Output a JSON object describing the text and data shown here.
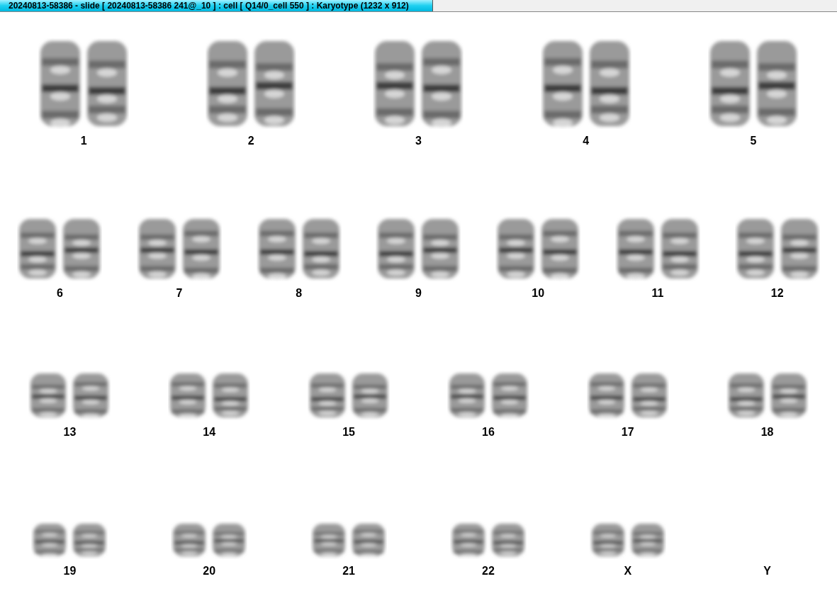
{
  "window": {
    "title": "20240813-58386 - slide [ 20240813-58386 241@_10 ] : cell [ Q14/0_cell 550 ] : Karyotype  (1232 x 912)"
  },
  "karyotype": {
    "rows": [
      {
        "groups": [
          {
            "label": "1",
            "kind": "pair"
          },
          {
            "label": "2",
            "kind": "pair"
          },
          {
            "label": "3",
            "kind": "pair"
          },
          {
            "label": "4",
            "kind": "pair"
          },
          {
            "label": "5",
            "kind": "pair"
          }
        ]
      },
      {
        "groups": [
          {
            "label": "6",
            "kind": "pair"
          },
          {
            "label": "7",
            "kind": "pair"
          },
          {
            "label": "8",
            "kind": "pair"
          },
          {
            "label": "9",
            "kind": "pair"
          },
          {
            "label": "10",
            "kind": "pair"
          },
          {
            "label": "11",
            "kind": "pair"
          },
          {
            "label": "12",
            "kind": "pair"
          }
        ]
      },
      {
        "groups": [
          {
            "label": "13",
            "kind": "pair"
          },
          {
            "label": "14",
            "kind": "pair"
          },
          {
            "label": "15",
            "kind": "pair"
          },
          {
            "label": "16",
            "kind": "pair"
          },
          {
            "label": "17",
            "kind": "pair"
          },
          {
            "label": "18",
            "kind": "pair"
          }
        ]
      },
      {
        "groups": [
          {
            "label": "19",
            "kind": "pair"
          },
          {
            "label": "20",
            "kind": "pair"
          },
          {
            "label": "21",
            "kind": "pair"
          },
          {
            "label": "22",
            "kind": "pair"
          },
          {
            "label": "X",
            "kind": "pair"
          },
          {
            "label": "Y",
            "kind": "empty"
          }
        ]
      }
    ]
  }
}
